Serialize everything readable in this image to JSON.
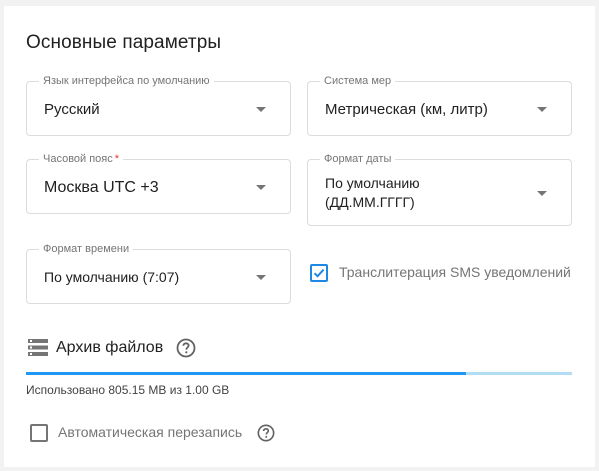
{
  "page": {
    "title": "Основные параметры"
  },
  "fields": {
    "language": {
      "label": "Язык интерфейса по умолчанию",
      "value": "Русский"
    },
    "units": {
      "label": "Система мер",
      "value": "Метрическая (км, литр)"
    },
    "timezone": {
      "label": "Часовой пояс",
      "required_mark": "*",
      "value": "Москва UTC +3"
    },
    "date_format": {
      "label": "Формат даты",
      "value": "По умолчанию\n(ДД.ММ.ГГГГ)"
    },
    "time_format": {
      "label": "Формат времени",
      "value": "По умолчанию (7:07)"
    }
  },
  "sms_translit": {
    "label": "Транслитерация SMS уведомлений",
    "checked": true
  },
  "archive": {
    "title": "Архив файлов",
    "usage_text": "Использовано 805.15 MB из 1.00 GB",
    "used_fraction": 0.805,
    "auto_overwrite": {
      "label": "Автоматическая перезапись",
      "checked": false
    }
  },
  "colors": {
    "accent": "#2196f3",
    "checkbox_checked": "#1e88e5",
    "required": "#e53935"
  },
  "icons": {
    "dropdown": "caret-down-icon",
    "archive": "storage-icon",
    "help": "help-circle-icon",
    "checkbox_checked": "check-icon"
  }
}
